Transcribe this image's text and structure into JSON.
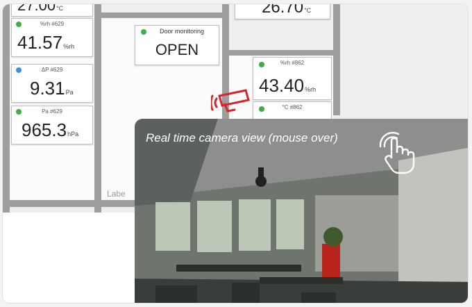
{
  "floorplan": {
    "top_left_value": "27.00",
    "top_left_unit": "°C",
    "top_right_value": "26.70",
    "top_right_unit": "°C",
    "room_label": "Labe"
  },
  "sensors": [
    {
      "id": "humidity-629",
      "header": "%rh #629",
      "value": "41.57",
      "unit": "%rh",
      "status_color": "#3cb043"
    },
    {
      "id": "pressure-diff-629",
      "header": "ΔP #629",
      "value": "9.31",
      "unit": "Pa",
      "status_color": "#3f8fd6"
    },
    {
      "id": "pressure-629",
      "header": "Pa #629",
      "value": "965.3",
      "unit": "hPa",
      "status_color": "#3cb043"
    },
    {
      "id": "humidity-862",
      "header": "%rh #862",
      "value": "43.40",
      "unit": "%rh",
      "status_color": "#3cb043"
    },
    {
      "id": "temperature-862",
      "header": "°C #862",
      "value": "",
      "unit": "",
      "status_color": "#3cb043"
    }
  ],
  "door": {
    "header": "Door monitoring",
    "state": "OPEN",
    "status_color": "#3cb043"
  },
  "camera": {
    "caption": "Real time camera view (mouse over)",
    "camera_icon": "security-camera-icon",
    "hover_icon": "tap-hand-icon",
    "icon_color": "#d9232d"
  }
}
